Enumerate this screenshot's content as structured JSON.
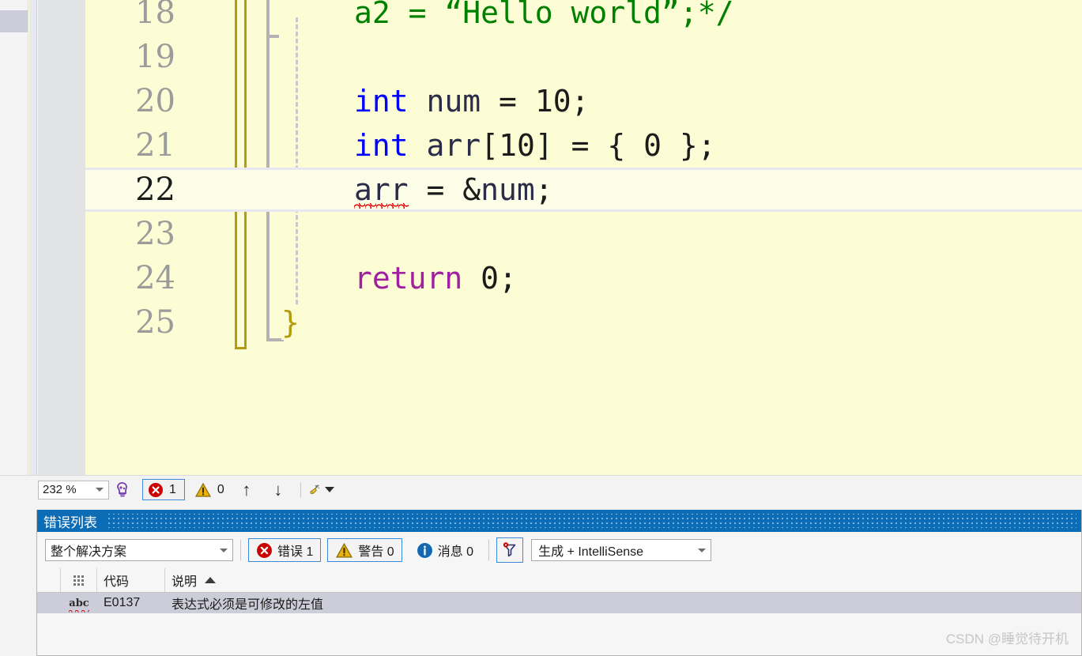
{
  "editor": {
    "background_color": "#fdfdd5",
    "current_line": 22,
    "lines": [
      {
        "number": "18",
        "tokens": [
          {
            "text": "a2 = ",
            "cls": "t-com"
          },
          {
            "text": "“Hello world”",
            "cls": "t-com"
          },
          {
            "text": ";*/",
            "cls": "t-com"
          }
        ]
      },
      {
        "number": "19",
        "tokens": []
      },
      {
        "number": "20",
        "tokens": [
          {
            "text": "int",
            "cls": "t-kw"
          },
          {
            "text": " ",
            "cls": "t-op"
          },
          {
            "text": "num",
            "cls": "t-id"
          },
          {
            "text": " = ",
            "cls": "t-op"
          },
          {
            "text": "10",
            "cls": "t-num"
          },
          {
            "text": ";",
            "cls": "t-op"
          }
        ]
      },
      {
        "number": "21",
        "tokens": [
          {
            "text": "int",
            "cls": "t-kw"
          },
          {
            "text": " ",
            "cls": "t-op"
          },
          {
            "text": "arr",
            "cls": "t-id"
          },
          {
            "text": "[",
            "cls": "t-brace"
          },
          {
            "text": "10",
            "cls": "t-num"
          },
          {
            "text": "] = { ",
            "cls": "t-op"
          },
          {
            "text": "0",
            "cls": "t-num"
          },
          {
            "text": " };",
            "cls": "t-op"
          }
        ]
      },
      {
        "number": "22",
        "tokens": [
          {
            "text": "arr",
            "cls": "t-id squiggle"
          },
          {
            "text": " = &",
            "cls": "t-op"
          },
          {
            "text": "num",
            "cls": "t-id"
          },
          {
            "text": ";",
            "cls": "t-op"
          }
        ]
      },
      {
        "number": "23",
        "tokens": []
      },
      {
        "number": "24",
        "tokens": [
          {
            "text": "return",
            "cls": "t-ctl"
          },
          {
            "text": " ",
            "cls": "t-op"
          },
          {
            "text": "0",
            "cls": "t-num"
          },
          {
            "text": ";",
            "cls": "t-op"
          }
        ]
      },
      {
        "number": "25",
        "tokens": [
          {
            "text": "}",
            "cls": "t-brace-hl"
          }
        ]
      }
    ],
    "code_text_lines": [
      "    a2 = “Hello world”;*/",
      "",
      "    int num = 10;",
      "    int arr[10] = { 0 };",
      "    arr = &num;",
      "",
      "    return 0;",
      "}"
    ]
  },
  "editor_status": {
    "zoom_level": "232 %",
    "zoom_icon": "intellicode-icon",
    "error_count": "1",
    "warning_count": "0",
    "prev_label": "↑",
    "next_label": "↓",
    "cleanup_icon": "broom-icon"
  },
  "error_panel": {
    "title": "错误列表",
    "title_bar_color": "#0c6cb5",
    "toolbar": {
      "scope_value": "整个解决方案",
      "errors_label": "错误 1",
      "warnings_label": "警告 0",
      "messages_label": "消息 0",
      "filter_icon": "filter-funnel-icon",
      "build_value": "生成 + IntelliSense"
    },
    "columns": [
      {
        "key": "spacer",
        "label": ""
      },
      {
        "key": "icon",
        "label": ""
      },
      {
        "key": "code",
        "label": "代码"
      },
      {
        "key": "description",
        "label": "说明",
        "sort": "asc"
      }
    ],
    "rows": [
      {
        "icon": "abc-spellcheck-icon",
        "code": "E0137",
        "description": "表达式必须是可修改的左值",
        "selected": true
      }
    ]
  },
  "watermark": {
    "text": "CSDN @睡觉待开机"
  }
}
